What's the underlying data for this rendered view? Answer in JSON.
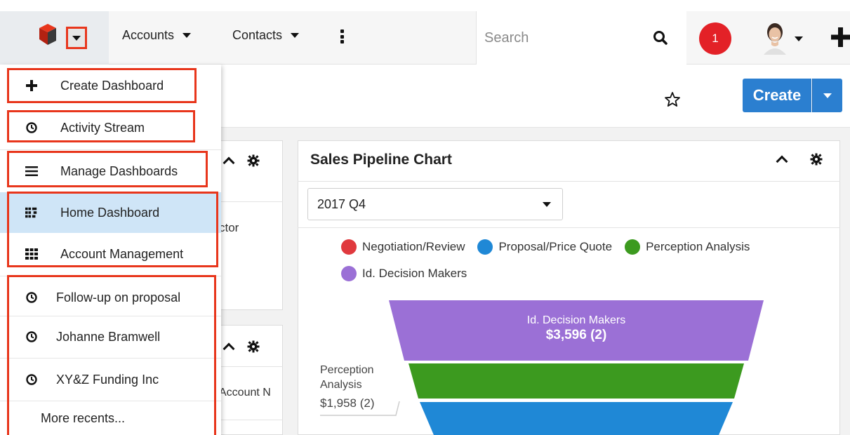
{
  "nav": {
    "items": [
      {
        "label": "Accounts"
      },
      {
        "label": "Contacts"
      }
    ],
    "search_placeholder": "Search",
    "notification_count": "1"
  },
  "header": {
    "create_label": "Create"
  },
  "menu": {
    "create_dashboard": "Create Dashboard",
    "activity_stream": "Activity Stream",
    "manage_dashboards": "Manage Dashboards",
    "dashboards": [
      {
        "label": "Home Dashboard",
        "active": true
      },
      {
        "label": "Account Management",
        "active": false
      }
    ],
    "recents": [
      {
        "label": "Follow-up on proposal"
      },
      {
        "label": "Johanne Bramwell"
      },
      {
        "label": "XY&Z Funding Inc"
      }
    ],
    "more_recents": "More recents..."
  },
  "left_dashlets": {
    "partial_text_1": "ctor",
    "partial_text_2": "Account N"
  },
  "main_dashlet": {
    "title": "Sales Pipeline Chart",
    "period": "2017 Q4"
  },
  "colors": {
    "accent": "#2b7fd0",
    "highlight": "#e8361c",
    "badge": "#e32127",
    "active_menu": "#cfe5f7"
  },
  "chart_data": {
    "type": "funnel",
    "title": "Sales Pipeline Chart",
    "legend": [
      {
        "name": "Negotiation/Review",
        "color": "#e0393e"
      },
      {
        "name": "Proposal/Price Quote",
        "color": "#1f88d6"
      },
      {
        "name": "Perception Analysis",
        "color": "#3c9a1f"
      },
      {
        "name": "Id. Decision Makers",
        "color": "#9b70d6"
      }
    ],
    "stages": [
      {
        "name": "Id. Decision Makers",
        "value_label": "$3,596 (2)",
        "amount": 3596,
        "count": 2,
        "color": "#9b70d6"
      },
      {
        "name": "Perception Analysis",
        "value_label": "$1,958 (2)",
        "amount": 1958,
        "count": 2,
        "color": "#3c9a1f"
      },
      {
        "name": "Proposal/Price Quote",
        "value_label": "",
        "color": "#1f88d6"
      }
    ],
    "callout": {
      "line1": "Perception",
      "line2": "Analysis",
      "line3": "$1,958 (2)"
    }
  }
}
